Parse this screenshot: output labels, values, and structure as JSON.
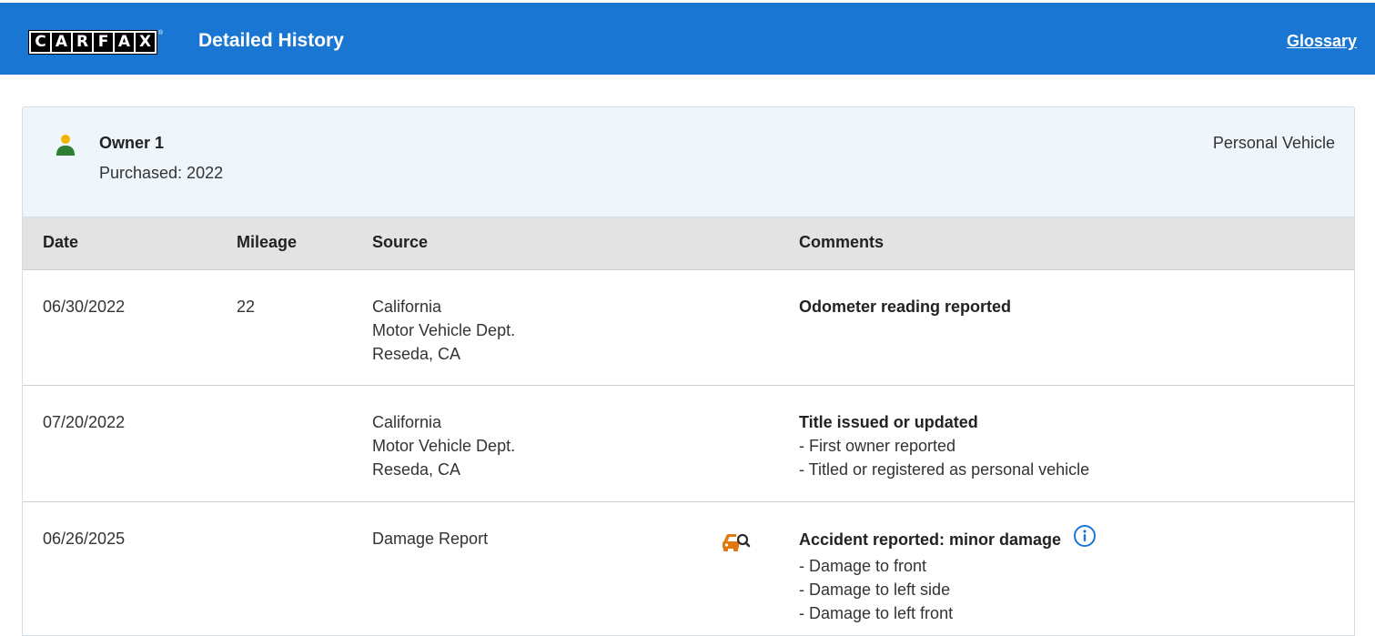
{
  "header": {
    "logo_letters": [
      "C",
      "A",
      "R",
      "F",
      "A",
      "X"
    ],
    "logo_tm": "®",
    "title": "Detailed History",
    "glossary_link": "Glossary",
    "bar_color": "#1976d2"
  },
  "owner": {
    "icon": "person-icon",
    "title": "Owner 1",
    "purchased": "Purchased: 2022",
    "vehicle_type": "Personal Vehicle"
  },
  "table": {
    "headers": {
      "date": "Date",
      "mileage": "Mileage",
      "source": "Source",
      "comments": "Comments"
    },
    "rows": [
      {
        "date": "06/30/2022",
        "mileage": "22",
        "source": [
          "California",
          "Motor Vehicle Dept.",
          "Reseda, CA"
        ],
        "comment_title": "Odometer reading reported",
        "comment_lines": []
      },
      {
        "date": "07/20/2022",
        "mileage": "",
        "source": [
          "California",
          "Motor Vehicle Dept.",
          "Reseda, CA"
        ],
        "comment_title": "Title issued or updated",
        "comment_lines": [
          "- First owner reported",
          "- Titled or registered as personal vehicle"
        ]
      },
      {
        "date": "06/26/2025",
        "mileage": "",
        "source": [
          "Damage Report"
        ],
        "source_icon": "damage-report-car-icon",
        "comment_title": "Accident reported: minor damage",
        "comment_info_icon": "info-icon",
        "comment_lines": [
          "- Damage to front",
          "- Damage to left side",
          "- Damage to left front"
        ]
      }
    ]
  }
}
